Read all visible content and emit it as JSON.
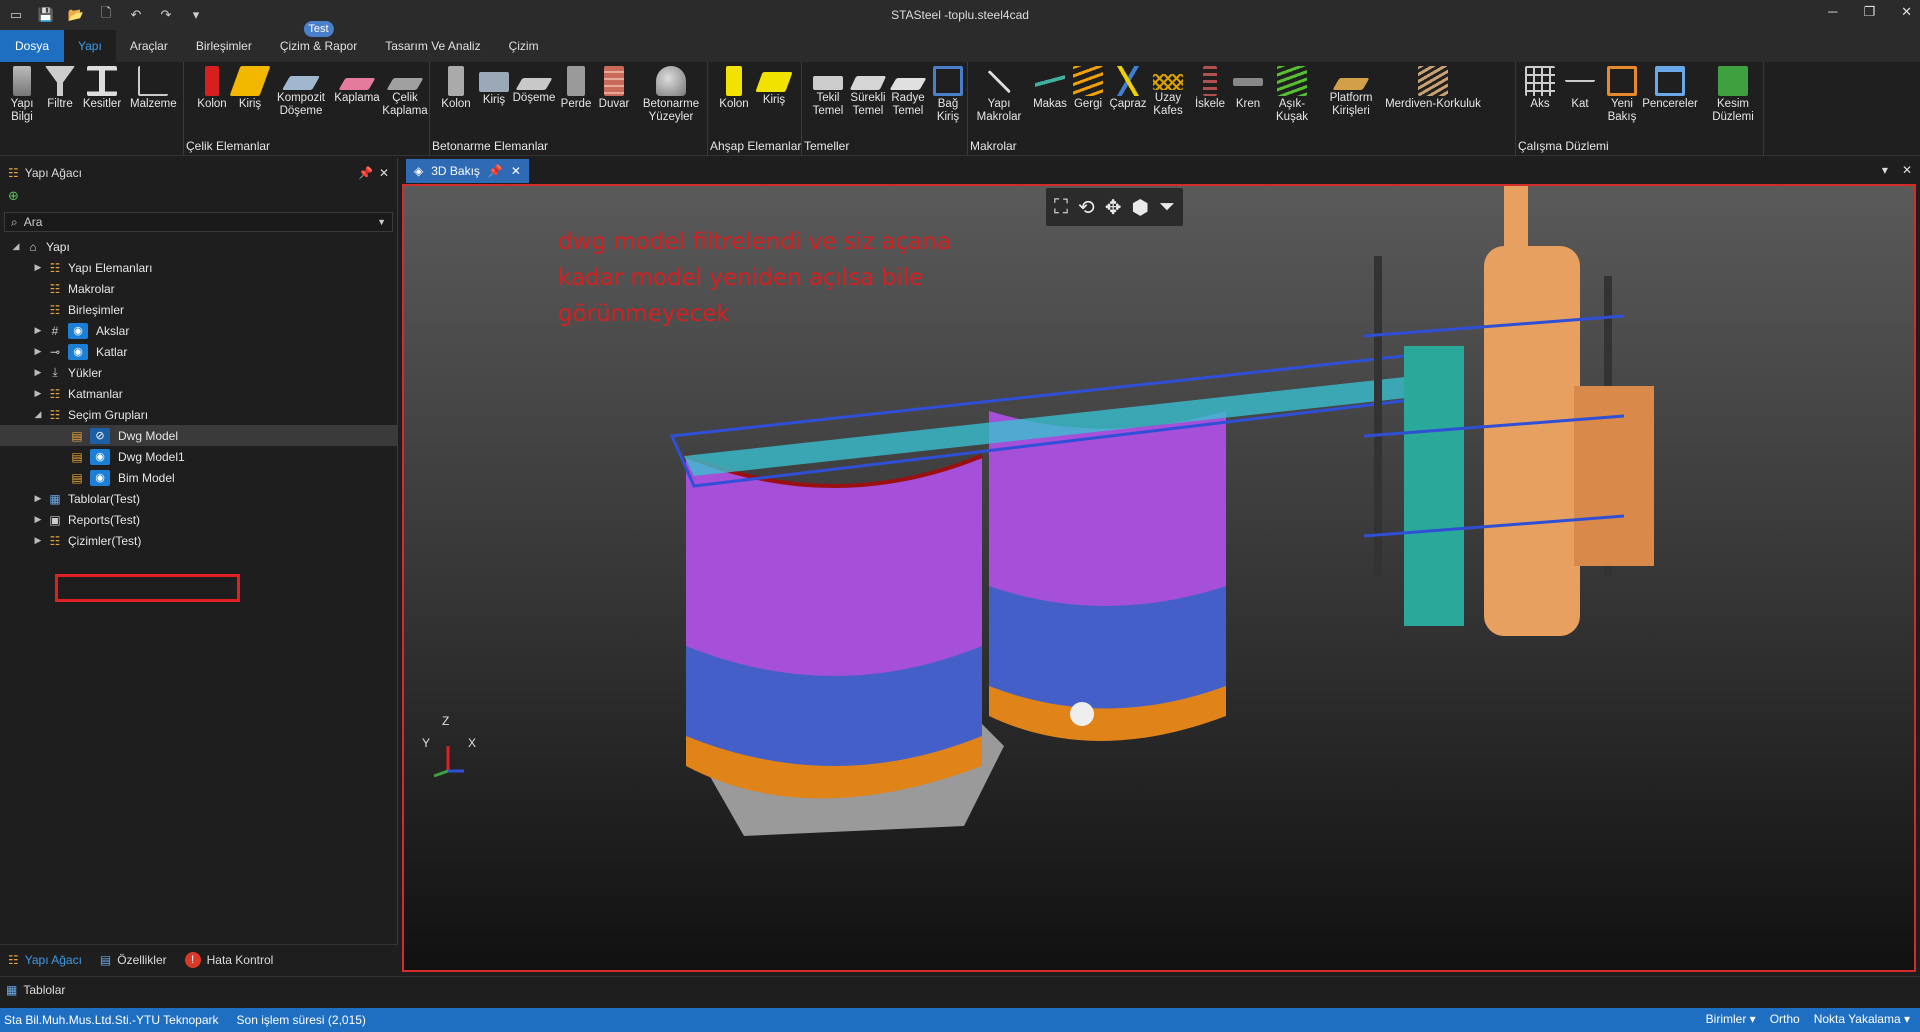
{
  "window": {
    "title": "STASteel -toplu.steel4cad",
    "minimize": "─",
    "restore": "❐",
    "close": "✕"
  },
  "qat": [
    "layout-icon",
    "save-icon",
    "open-folder-icon",
    "new-file-icon",
    "undo-icon",
    "redo-icon",
    "more-icon"
  ],
  "menu": [
    {
      "label": "Dosya",
      "key": "file"
    },
    {
      "label": "Yapı",
      "key": "yapi"
    },
    {
      "label": "Araçlar",
      "key": "araclar"
    },
    {
      "label": "Birleşimler",
      "key": "birlesimler"
    },
    {
      "label": "Çizim & Rapor",
      "key": "cizim-rapor",
      "badge": "Test"
    },
    {
      "label": "Tasarım Ve Analiz",
      "key": "tasarim"
    },
    {
      "label": "Çizim",
      "key": "cizim"
    }
  ],
  "ribbon": {
    "groups": [
      {
        "label": "",
        "buttons": [
          "Yapı Bilgi",
          "Filtre",
          "Kesitler",
          "Malzeme"
        ]
      },
      {
        "label": "Çelik Elemanlar",
        "buttons": [
          "Kolon",
          "Kiriş",
          "Kompozit Döşeme",
          "Kaplama",
          "Çelik Kaplama"
        ]
      },
      {
        "label": "Betonarme Elemanlar",
        "buttons": [
          "Kolon",
          "Kiriş",
          "Döşeme",
          "Perde",
          "Duvar",
          "Betonarme Yüzeyler"
        ]
      },
      {
        "label": "Ahşap Elemanlar",
        "buttons": [
          "Kolon",
          "Kiriş"
        ]
      },
      {
        "label": "Temeller",
        "buttons": [
          "Tekil Temel",
          "Sürekli Temel",
          "Radye Temel",
          "Bağ Kiriş"
        ]
      },
      {
        "label": "Makrolar",
        "buttons": [
          "Yapı Makrolar",
          "Makas",
          "Gergi",
          "Çapraz",
          "Uzay Kafes",
          "İskele",
          "Kren",
          "Aşık-Kuşak",
          "Platform Kirişleri",
          "Merdiven-Korkuluk"
        ]
      },
      {
        "label": "Çalışma Düzlemi",
        "buttons": [
          "Aks",
          "Kat",
          "Yeni Bakış",
          "Pencereler",
          "Kesim Düzlemi"
        ]
      }
    ]
  },
  "left_panel": {
    "title": "Yapı Ağacı",
    "search_placeholder": "Ara",
    "tree": [
      {
        "label": "Yapı",
        "level": 0,
        "arrow": "◢",
        "icon": "building-icon"
      },
      {
        "label": "Yapı Elemanları",
        "level": 1,
        "arrow": "▶",
        "icon": "tree-icon"
      },
      {
        "label": "Makrolar",
        "level": 1,
        "arrow": "",
        "icon": "tree-icon"
      },
      {
        "label": "Birleşimler",
        "level": 1,
        "arrow": "",
        "icon": "tree-icon"
      },
      {
        "label": "Akslar",
        "level": 1,
        "arrow": "▶",
        "icon": "grid-icon",
        "eye": true
      },
      {
        "label": "Katlar",
        "level": 1,
        "arrow": "▶",
        "icon": "level-icon",
        "eye": true
      },
      {
        "label": "Yükler",
        "level": 1,
        "arrow": "▶",
        "icon": "load-icon"
      },
      {
        "label": "Katmanlar",
        "level": 1,
        "arrow": "▶",
        "icon": "tree-icon"
      },
      {
        "label": "Seçim Grupları",
        "level": 1,
        "arrow": "◢",
        "icon": "tree-icon"
      },
      {
        "label": "Dwg Model",
        "level": 2,
        "arrow": "",
        "icon": "group-icon",
        "eye": true,
        "eye_off": true,
        "selected": true
      },
      {
        "label": "Dwg Model1",
        "level": 2,
        "arrow": "",
        "icon": "group-icon",
        "eye": true
      },
      {
        "label": "Bim Model",
        "level": 2,
        "arrow": "",
        "icon": "group-icon",
        "eye": true
      },
      {
        "label": "Tablolar(Test)",
        "level": 1,
        "arrow": "▶",
        "icon": "table-icon"
      },
      {
        "label": "Reports(Test)",
        "level": 1,
        "arrow": "▶",
        "icon": "report-icon"
      },
      {
        "label": "Çizimler(Test)",
        "level": 1,
        "arrow": "▶",
        "icon": "tree-icon"
      }
    ],
    "bottom_tabs": [
      "Yapı Ağacı",
      "Özellikler",
      "Hata Kontrol"
    ]
  },
  "doc_tab": {
    "label": "3D Bakış"
  },
  "viewport": {
    "annotation_lines": [
      "dwg model filtrelendi ve siz açana",
      "kadar model yeniden açılsa bile",
      "görünmeyecek"
    ],
    "axes": {
      "z": "Z",
      "y": "Y",
      "x": "X"
    }
  },
  "tablolar_label": "Tablolar",
  "status": {
    "company": "Sta Bil.Muh.Mus.Ltd.Sti.-YTU Teknopark",
    "last_op": "Son işlem süresi (2,015)",
    "units": "Birimler",
    "ortho": "Ortho",
    "snap": "Nokta Yakalama"
  },
  "colors": {
    "accent": "#1e6fc1",
    "highlight": "#e02020",
    "annotation": "#d42020"
  }
}
